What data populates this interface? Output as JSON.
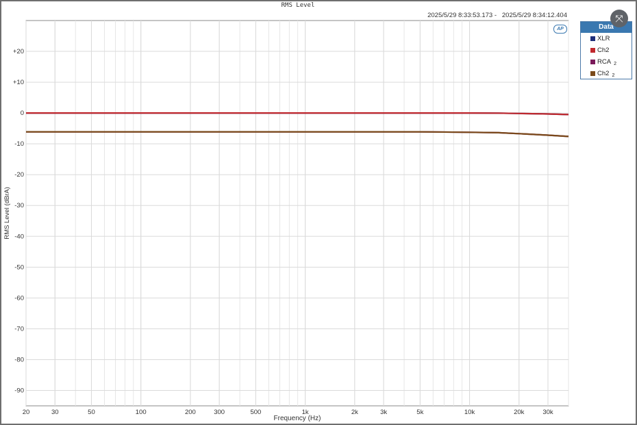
{
  "window": {
    "timestamp": "2025/5/29 8:33:53.173 -   2025/5/29 8:34:12.404",
    "logo_text": "AP",
    "close_glyph": "⤧"
  },
  "legend": {
    "title": "Data",
    "items": [
      {
        "label": "XLR",
        "sub": "",
        "color": "#1f2f7a"
      },
      {
        "label": "Ch2",
        "sub": "",
        "color": "#c0282d"
      },
      {
        "label": "RCA",
        "sub": "2",
        "color": "#7a1a5a"
      },
      {
        "label": "Ch2",
        "sub": "2",
        "color": "#7a4a1a"
      }
    ]
  },
  "chart_data": {
    "type": "line",
    "title": "RMS Level",
    "xlabel": "Frequency (Hz)",
    "ylabel": "RMS Level (dBrA)",
    "xscale": "log",
    "xlim": [
      20,
      40000
    ],
    "ylim": [
      -95,
      30
    ],
    "grid": true,
    "x_ticks": [
      20,
      30,
      50,
      100,
      200,
      300,
      500,
      1000,
      2000,
      3000,
      5000,
      10000,
      20000,
      30000
    ],
    "x_tick_labels": [
      "20",
      "30",
      "50",
      "100",
      "200",
      "300",
      "500",
      "1k",
      "2k",
      "3k",
      "5k",
      "10k",
      "20k",
      "30k"
    ],
    "y_ticks": [
      20,
      10,
      0,
      -10,
      -20,
      -30,
      -40,
      -50,
      -60,
      -70,
      -80,
      -90
    ],
    "y_tick_labels": [
      "+20",
      "+10",
      "0",
      "-10",
      "-20",
      "-30",
      "-40",
      "-50",
      "-60",
      "-70",
      "-80",
      "-90"
    ],
    "series": [
      {
        "name": "XLR",
        "color": "#1f2f7a",
        "x": [
          20,
          100,
          1000,
          10000,
          15000,
          20000,
          30000,
          40000
        ],
        "y": [
          0,
          0,
          0,
          0,
          -0.05,
          -0.15,
          -0.3,
          -0.5
        ]
      },
      {
        "name": "Ch2",
        "color": "#c0282d",
        "x": [
          20,
          100,
          1000,
          10000,
          15000,
          20000,
          30000,
          40000
        ],
        "y": [
          0,
          0,
          0,
          0,
          -0.05,
          -0.15,
          -0.3,
          -0.5
        ]
      },
      {
        "name": "RCA 2",
        "color": "#7a1a5a",
        "x": [
          20,
          100,
          1000,
          5000,
          10000,
          15000,
          20000,
          30000,
          40000
        ],
        "y": [
          -6.1,
          -6.1,
          -6.1,
          -6.1,
          -6.25,
          -6.4,
          -6.7,
          -7.2,
          -7.6
        ]
      },
      {
        "name": "Ch2 2",
        "color": "#7a4a1a",
        "x": [
          20,
          100,
          1000,
          5000,
          10000,
          15000,
          20000,
          30000,
          40000
        ],
        "y": [
          -6.1,
          -6.1,
          -6.1,
          -6.1,
          -6.25,
          -6.4,
          -6.7,
          -7.2,
          -7.6
        ]
      }
    ]
  }
}
